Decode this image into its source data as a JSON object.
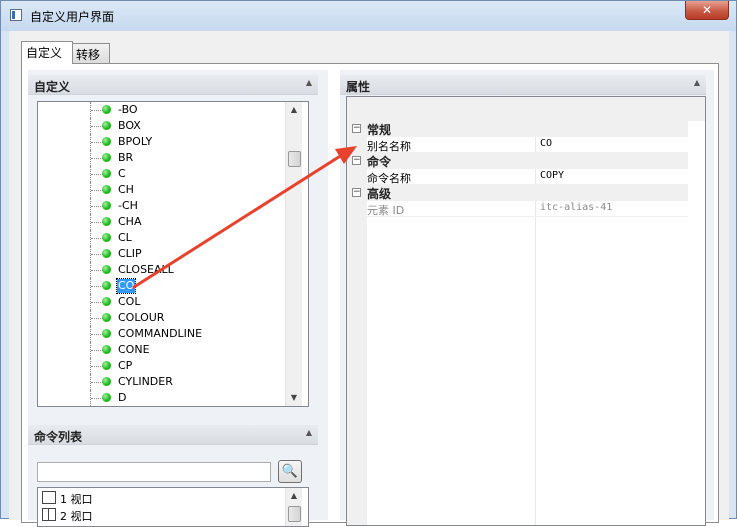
{
  "window": {
    "title": "自定义用户界面",
    "close_glyph": "✕"
  },
  "tabs": [
    {
      "label": "自定义"
    },
    {
      "label": "转移"
    }
  ],
  "customize_panel": {
    "header": "自定义",
    "collapse_glyph": "▲",
    "items": [
      {
        "label": "-BO"
      },
      {
        "label": "BOX"
      },
      {
        "label": "BPOLY"
      },
      {
        "label": "BR"
      },
      {
        "label": "C"
      },
      {
        "label": "CH"
      },
      {
        "label": "-CH"
      },
      {
        "label": "CHA"
      },
      {
        "label": "CL"
      },
      {
        "label": "CLIP"
      },
      {
        "label": "CLOSEALL"
      },
      {
        "label": "CO"
      },
      {
        "label": "COL"
      },
      {
        "label": "COLOUR"
      },
      {
        "label": "COMMANDLINE"
      },
      {
        "label": "CONE"
      },
      {
        "label": "CP"
      },
      {
        "label": "CYLINDER"
      },
      {
        "label": "D"
      }
    ],
    "selected_item": "CO"
  },
  "command_list_panel": {
    "header": "命令列表",
    "collapse_glyph": "▲",
    "search_value": "",
    "search_glyph": "🔍",
    "commands": [
      {
        "label": "1 视口",
        "icon": "single-viewport-icon"
      },
      {
        "label": "2 视口",
        "icon": "split-viewport-icon"
      }
    ]
  },
  "properties_panel": {
    "header": "属性",
    "collapse_glyph": "▲",
    "categories": [
      {
        "label": "常规",
        "expander": "−",
        "rows": [
          {
            "name": "别名名称",
            "value": "CO",
            "readonly": false
          }
        ]
      },
      {
        "label": "命令",
        "expander": "−",
        "rows": [
          {
            "name": "命令名称",
            "value": "COPY",
            "readonly": false
          }
        ]
      },
      {
        "label": "高级",
        "expander": "−",
        "rows": [
          {
            "name": "元素 ID",
            "value": "itc-alias-41",
            "readonly": true
          }
        ]
      }
    ]
  },
  "scroll_glyphs": {
    "up": "▲",
    "down": "▼"
  },
  "colors": {
    "selection": "#3399ff",
    "annotation_arrow": "#e8412c",
    "status_dot": "#18b815"
  }
}
